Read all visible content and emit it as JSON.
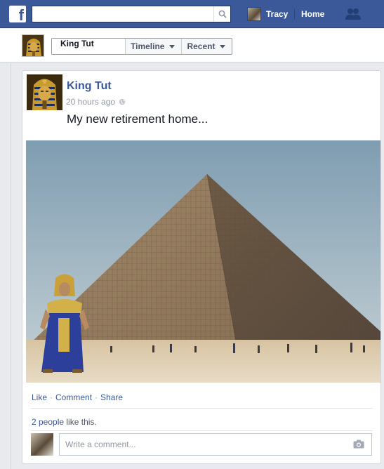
{
  "topbar": {
    "logo": "f",
    "search_placeholder": "",
    "user_name": "Tracy",
    "home_label": "Home",
    "icons": [
      "search-icon",
      "friend-requests-icon"
    ]
  },
  "timeline_bar": {
    "profile_name": "King Tut",
    "timeline_label": "Timeline",
    "recent_label": "Recent"
  },
  "post": {
    "author": "King Tut",
    "timestamp": "20 hours ago",
    "privacy_icon": "globe-icon",
    "text": "My new retirement home...",
    "image_icon": "pyramid-photo",
    "actions": {
      "like": "Like",
      "comment": "Comment",
      "share": "Share",
      "separator": "·"
    },
    "likes": {
      "count_text": "2 people",
      "suffix": "like this."
    },
    "comment_placeholder": "Write a comment...",
    "camera_icon": "camera-icon"
  },
  "colors": {
    "brand": "#3b5998",
    "link": "#3b5998",
    "muted": "#9197a3",
    "bg": "#e9eaed"
  }
}
